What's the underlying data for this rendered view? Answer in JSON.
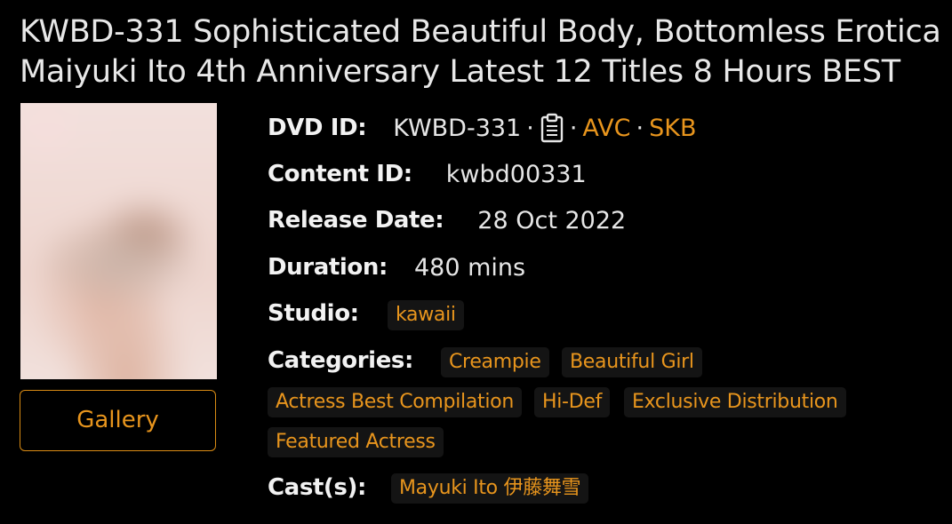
{
  "title": "KWBD-331 Sophisticated Beautiful Body, Bottomless Erotica Maiyuki Ito 4th Anniversary Latest 12 Titles 8 Hours BEST",
  "gallery_button": "Gallery",
  "details": {
    "dvd_id": {
      "label": "DVD ID:",
      "value": "KWBD-331",
      "sep": "·",
      "copy_icon": "clipboard-icon",
      "codec": "AVC",
      "source": "SKB"
    },
    "content_id": {
      "label": "Content ID:",
      "value": "kwbd00331"
    },
    "release_date": {
      "label": "Release Date:",
      "value": "28 Oct 2022"
    },
    "duration": {
      "label": "Duration:",
      "value": "480 mins"
    },
    "studio": {
      "label": "Studio:",
      "value": "kawaii"
    },
    "categories": {
      "label": "Categories:",
      "items": [
        "Creampie",
        "Beautiful Girl",
        "Actress Best Compilation",
        "Hi-Def",
        "Exclusive Distribution",
        "Featured Actress"
      ]
    },
    "cast": {
      "label": "Cast(s):",
      "items": [
        "Mayuki Ito 伊藤舞雪"
      ]
    }
  },
  "colors": {
    "background": "#000000",
    "accent": "#e8951d",
    "text": "#e6e6e6",
    "tag_background": "#141414"
  }
}
